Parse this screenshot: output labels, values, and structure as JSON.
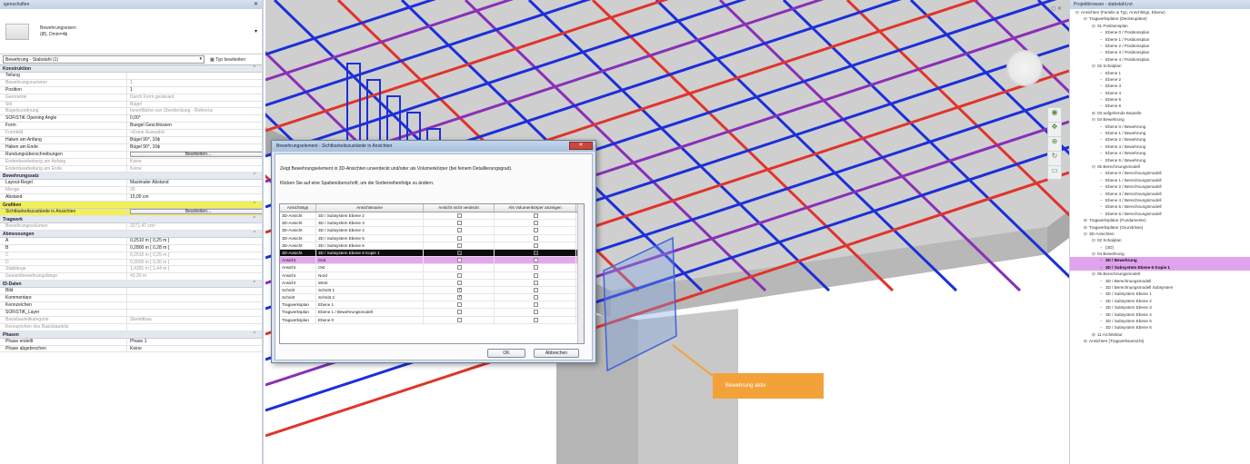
{
  "properties": {
    "title": "igenschaften",
    "type_name_line1": "Bewehrungseisen",
    "type_name_line2": "(Ø), Dmin=4ϕ",
    "selector": "Bewehrung - Stabstahl (1)",
    "type_edit": "Typ bearbeiten",
    "sections": [
      {
        "name": "Konstruktion",
        "highlight": false,
        "rows": [
          {
            "label": "Teilung",
            "value": "",
            "dim": false
          },
          {
            "label": "Bewehrungsnummer",
            "value": "1",
            "dim": true
          },
          {
            "label": "Position",
            "value": "1",
            "dim": false
          },
          {
            "label": "Geometrie",
            "value": "Durch Form gesteuert",
            "dim": true
          },
          {
            "label": "Stil",
            "value": "Bügel",
            "dim": true
          },
          {
            "label": "Bügelzuordnung",
            "value": "Innenfläche von Überdeckung - Referenz",
            "dim": true
          },
          {
            "label": "SOFiSTiK Opening Angle",
            "value": "0,00°",
            "dim": false
          },
          {
            "label": "Form",
            "value": "Buegel Geschlossen",
            "dim": false
          },
          {
            "label": "Formbild",
            "value": "<Keine Auswahl>",
            "dim": true
          },
          {
            "label": "Haken am Anfang",
            "value": "Bügel 90°, 10ϕ",
            "dim": false
          },
          {
            "label": "Haken am Ende",
            "value": "Bügel 90°, 10ϕ",
            "dim": false
          },
          {
            "label": "Rundungsüberschreibungen",
            "value": "Bearbeiten...",
            "button": true,
            "dim": false
          },
          {
            "label": "Endenbearbeitung am Anfang",
            "value": "Keine",
            "dim": true
          },
          {
            "label": "Endenbearbeitung am Ende",
            "value": "Keine",
            "dim": true
          }
        ]
      },
      {
        "name": "Bewehrungssatz",
        "highlight": false,
        "rows": [
          {
            "label": "Layout-Regel",
            "value": "Maximaler Abstand",
            "dim": false
          },
          {
            "label": "Menge",
            "value": "30",
            "dim": true
          },
          {
            "label": "Abstand",
            "value": "15,00 cm",
            "dim": false
          }
        ]
      },
      {
        "name": "Grafiken",
        "highlight": true,
        "rows": [
          {
            "label": "Sichtbarkeitszustände in Ansichten",
            "value": "Bearbeiten...",
            "button": true,
            "highlight": true,
            "dim": false
          }
        ]
      },
      {
        "name": "Tragwerk",
        "highlight": false,
        "rows": [
          {
            "label": "Bewehrungsvolumen",
            "value": "2271,47 cm³",
            "dim": true
          }
        ]
      },
      {
        "name": "Abmessungen",
        "highlight": false,
        "rows": [
          {
            "label": "A",
            "value": "0,2510 m [ 0,25 m ]",
            "dim": false
          },
          {
            "label": "B",
            "value": "0,2800 m [ 0,28 m ]",
            "dim": false
          },
          {
            "label": "C",
            "value": "0,2510 m [ 0,25 m ]",
            "dim": true
          },
          {
            "label": "D",
            "value": "0,3000 m [ 0,30 m ]",
            "dim": true
          },
          {
            "label": "Stablänge",
            "value": "1,4391 m [ 1,44 m ]",
            "dim": true
          },
          {
            "label": "Gesamtbewehrungslänge",
            "value": "43,20 m",
            "dim": true
          }
        ]
      },
      {
        "name": "ID-Daten",
        "highlight": false,
        "rows": [
          {
            "label": "Bild",
            "value": "",
            "dim": false
          },
          {
            "label": "Kommentare",
            "value": "",
            "dim": false
          },
          {
            "label": "Kennzeichen",
            "value": "",
            "dim": false
          },
          {
            "label": "SOFiSTiK_Layer",
            "value": "",
            "dim": false
          },
          {
            "label": "Basisbauteilkategorie",
            "value": "Skelettbau",
            "dim": true
          },
          {
            "label": "Kennzeichen des Basisbauteils",
            "value": "",
            "dim": true
          }
        ]
      },
      {
        "name": "Phasen",
        "highlight": false,
        "rows": [
          {
            "label": "Phase erstellt",
            "value": "Phase 1",
            "dim": false
          },
          {
            "label": "Phase abgebrochen",
            "value": "Keine",
            "dim": false
          }
        ]
      }
    ]
  },
  "dialog": {
    "title": "Bewehrungselement - Sichtbarkeitszustände in Ansichten",
    "close": "✕",
    "description": "Zeigt Bewehrungselement in 3D-Ansichten unverdeckt und/oder als Volumenkörper (bei feinem Detaillierungsgrad).",
    "sort_hint": "Klicken Sie auf eine Spaltenüberschrift, um die Sortierreihenfolge zu ändern.",
    "columns": [
      "Ansichtstyp",
      "Ansichtsname",
      "Ansicht nicht verdeckt",
      "Als Volumenkörper anzeigen"
    ],
    "rows": [
      {
        "type": "3D-Ansicht",
        "name": "3D / Subsystem Ebene 2",
        "unobscured": false,
        "solid": false,
        "style": ""
      },
      {
        "type": "3D-Ansicht",
        "name": "3D / Subsystem Ebene 3",
        "unobscured": false,
        "solid": false,
        "style": ""
      },
      {
        "type": "3D-Ansicht",
        "name": "3D / Subsystem Ebene 4",
        "unobscured": false,
        "solid": false,
        "style": ""
      },
      {
        "type": "3D-Ansicht",
        "name": "3D / Subsystem Ebene 5",
        "unobscured": false,
        "solid": false,
        "style": ""
      },
      {
        "type": "3D-Ansicht",
        "name": "3D / Subsystem Ebene 6",
        "unobscured": false,
        "solid": false,
        "style": ""
      },
      {
        "type": "3D-Ansicht",
        "name": "3D / Subsystem Ebene 6 Kopie 1",
        "unobscured": true,
        "solid": true,
        "style": "sel"
      },
      {
        "type": "Ansicht",
        "name": "Süd",
        "unobscured": false,
        "solid": false,
        "style": "mag"
      },
      {
        "type": "Ansicht",
        "name": "Ost",
        "unobscured": false,
        "solid": false,
        "style": ""
      },
      {
        "type": "Ansicht",
        "name": "Nord",
        "unobscured": false,
        "solid": false,
        "style": ""
      },
      {
        "type": "Ansicht",
        "name": "West",
        "unobscured": false,
        "solid": false,
        "style": ""
      },
      {
        "type": "Schnitt",
        "name": "Schnitt 1",
        "unobscured": true,
        "solid": false,
        "style": ""
      },
      {
        "type": "Schnitt",
        "name": "Schnitt 2",
        "unobscured": true,
        "solid": false,
        "style": ""
      },
      {
        "type": "Tragwerksplan",
        "name": "Ebene 1",
        "unobscured": false,
        "solid": false,
        "style": ""
      },
      {
        "type": "Tragwerksplan",
        "name": "Ebene 1 / Bewehrungsmodell",
        "unobscured": false,
        "solid": false,
        "style": ""
      },
      {
        "type": "Tragwerksplan",
        "name": "Ebene 0",
        "unobscured": false,
        "solid": false,
        "style": ""
      }
    ],
    "ok": "OK",
    "cancel": "Abbrechen"
  },
  "callout": "Bewehrung aktiv",
  "browser": {
    "title": "Projektbrowser - stabstahl.rvt",
    "nodes": [
      {
        "indent": 0,
        "text": "Ansichten (Familie & Typ, Anschlstyp, Ebene)",
        "toggle": "⊟",
        "hl": false
      },
      {
        "indent": 1,
        "text": "Tragwerkspläne (Deckenpläne)",
        "toggle": "⊟",
        "hl": false
      },
      {
        "indent": 2,
        "text": "01 Positionsplan",
        "toggle": "⊟",
        "hl": false
      },
      {
        "indent": 3,
        "text": "Ebene 0 / Positionsplan",
        "toggle": "",
        "hl": false
      },
      {
        "indent": 3,
        "text": "Ebene 1 / Positionsplan",
        "toggle": "",
        "hl": false
      },
      {
        "indent": 3,
        "text": "Ebene 2 / Positionsplan",
        "toggle": "",
        "hl": false
      },
      {
        "indent": 3,
        "text": "Ebene 3 / Positionsplan",
        "toggle": "",
        "hl": false
      },
      {
        "indent": 3,
        "text": "Ebene 4 / Positionsplan",
        "toggle": "",
        "hl": false
      },
      {
        "indent": 2,
        "text": "02 Schalplan",
        "toggle": "⊟",
        "hl": false
      },
      {
        "indent": 3,
        "text": "Ebene 1",
        "toggle": "",
        "hl": false
      },
      {
        "indent": 3,
        "text": "Ebene 2",
        "toggle": "",
        "hl": false
      },
      {
        "indent": 3,
        "text": "Ebene 3",
        "toggle": "",
        "hl": false
      },
      {
        "indent": 3,
        "text": "Ebene 4",
        "toggle": "",
        "hl": false
      },
      {
        "indent": 3,
        "text": "Ebene 5",
        "toggle": "",
        "hl": false
      },
      {
        "indent": 3,
        "text": "Ebene 6",
        "toggle": "",
        "hl": false
      },
      {
        "indent": 2,
        "text": "03 aufgehende Bauteile",
        "toggle": "⊞",
        "hl": false
      },
      {
        "indent": 2,
        "text": "04 Bewehrung",
        "toggle": "⊟",
        "hl": false
      },
      {
        "indent": 3,
        "text": "Ebene 0 / Bewehrung",
        "toggle": "",
        "hl": false
      },
      {
        "indent": 3,
        "text": "Ebene 1 / Bewehrung",
        "toggle": "",
        "hl": false
      },
      {
        "indent": 3,
        "text": "Ebene 2 / Bewehrung",
        "toggle": "",
        "hl": false
      },
      {
        "indent": 3,
        "text": "Ebene 3 / Bewehrung",
        "toggle": "",
        "hl": false
      },
      {
        "indent": 3,
        "text": "Ebene 4 / Bewehrung",
        "toggle": "",
        "hl": false
      },
      {
        "indent": 3,
        "text": "Ebene 6 / Bewehrung",
        "toggle": "",
        "hl": false
      },
      {
        "indent": 2,
        "text": "05 Berechnungsmodell",
        "toggle": "⊟",
        "hl": false
      },
      {
        "indent": 3,
        "text": "Ebene 0 / Berechnungsmodell",
        "toggle": "",
        "hl": false
      },
      {
        "indent": 3,
        "text": "Ebene 1 / Berechnungsmodell",
        "toggle": "",
        "hl": false
      },
      {
        "indent": 3,
        "text": "Ebene 2 / Berechnungsmodell",
        "toggle": "",
        "hl": false
      },
      {
        "indent": 3,
        "text": "Ebene 3 / Berechnungsmodell",
        "toggle": "",
        "hl": false
      },
      {
        "indent": 3,
        "text": "Ebene 4 / Berechnungsmodell",
        "toggle": "",
        "hl": false
      },
      {
        "indent": 3,
        "text": "Ebene 5 / Berechnungsmodell",
        "toggle": "",
        "hl": false
      },
      {
        "indent": 3,
        "text": "Ebene 6 / Berechnungsmodell",
        "toggle": "",
        "hl": false
      },
      {
        "indent": 1,
        "text": "Tragwerkspläne (Fundamente)",
        "toggle": "⊞",
        "hl": false
      },
      {
        "indent": 1,
        "text": "Tragwerkspläne (Grundrisse)",
        "toggle": "⊞",
        "hl": false
      },
      {
        "indent": 1,
        "text": "3D-Ansichten",
        "toggle": "⊟",
        "hl": false
      },
      {
        "indent": 2,
        "text": "02 Schalplan",
        "toggle": "⊟",
        "hl": false
      },
      {
        "indent": 3,
        "text": "{3D}",
        "toggle": "",
        "hl": false
      },
      {
        "indent": 2,
        "text": "04 Bewehrung",
        "toggle": "⊟",
        "hl": false
      },
      {
        "indent": 3,
        "text": "3D / Bewehrung",
        "toggle": "",
        "hl": true
      },
      {
        "indent": 3,
        "text": "3D / Subsystem Ebene 6 Kopie 1",
        "toggle": "",
        "hl": true
      },
      {
        "indent": 2,
        "text": "05 Berechnungsmodell",
        "toggle": "⊟",
        "hl": false
      },
      {
        "indent": 3,
        "text": "3D / Berechnungsmodell",
        "toggle": "",
        "hl": false
      },
      {
        "indent": 3,
        "text": "3D / Berechnungsmodell Subsystem",
        "toggle": "",
        "hl": false
      },
      {
        "indent": 3,
        "text": "3D / Subsystem Ebene 1",
        "toggle": "",
        "hl": false
      },
      {
        "indent": 3,
        "text": "3D / Subsystem Ebene 2",
        "toggle": "",
        "hl": false
      },
      {
        "indent": 3,
        "text": "3D / Subsystem Ebene 3",
        "toggle": "",
        "hl": false
      },
      {
        "indent": 3,
        "text": "3D / Subsystem Ebene 4",
        "toggle": "",
        "hl": false
      },
      {
        "indent": 3,
        "text": "3D / Subsystem Ebene 5",
        "toggle": "",
        "hl": false
      },
      {
        "indent": 3,
        "text": "3D / Subsystem Ebene 6",
        "toggle": "",
        "hl": false
      },
      {
        "indent": 2,
        "text": "11 Architektur",
        "toggle": "⊞",
        "hl": false
      },
      {
        "indent": 1,
        "text": "Ansichten (Tragwerksansicht)",
        "toggle": "⊞",
        "hl": false
      }
    ]
  },
  "colors": {
    "highlight_yellow": "#f2f05a",
    "highlight_magenta": "#e0a4ef",
    "callout_orange": "#f3a23a",
    "rebar_red": "#e0342c",
    "rebar_blue": "#1c2fd8",
    "rebar_purple": "#8a2fb8",
    "rebar_green": "#3f9a3a"
  }
}
